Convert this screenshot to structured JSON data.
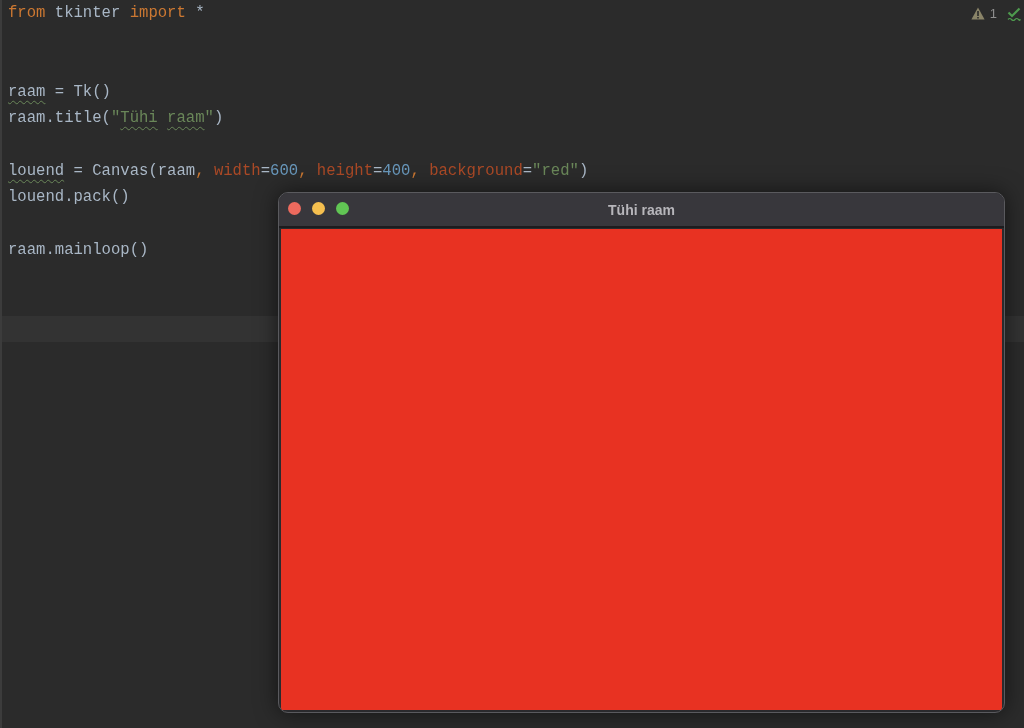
{
  "editor": {
    "inspections": {
      "warning_count": "1"
    },
    "lines": [
      {
        "kind": "code",
        "tokens": [
          {
            "text": "from",
            "kind": "keyword",
            "typo": false
          },
          {
            "text": " tkinter ",
            "kind": "plain",
            "typo": false
          },
          {
            "text": "import",
            "kind": "keyword",
            "typo": false
          },
          {
            "text": " *",
            "kind": "plain",
            "typo": false
          }
        ]
      },
      {
        "kind": "blank"
      },
      {
        "kind": "blank"
      },
      {
        "kind": "code",
        "tokens": [
          {
            "text": "raam",
            "kind": "plain",
            "typo": true
          },
          {
            "text": " = Tk()",
            "kind": "plain",
            "typo": false
          }
        ]
      },
      {
        "kind": "code",
        "tokens": [
          {
            "text": "raam.title(",
            "kind": "plain",
            "typo": false
          },
          {
            "text": "\"",
            "kind": "string",
            "typo": false
          },
          {
            "text": "Tühi",
            "kind": "string",
            "typo": true
          },
          {
            "text": " raam",
            "kind": "string",
            "typo": true
          },
          {
            "text": "\"",
            "kind": "string",
            "typo": false
          },
          {
            "text": ")",
            "kind": "plain",
            "typo": false
          }
        ]
      },
      {
        "kind": "blank"
      },
      {
        "kind": "code",
        "tokens": [
          {
            "text": "louend",
            "kind": "plain",
            "typo": true
          },
          {
            "text": " = Canvas(raam",
            "kind": "plain",
            "typo": false
          },
          {
            "text": ", ",
            "kind": "comma",
            "typo": false
          },
          {
            "text": "width",
            "kind": "param",
            "typo": false
          },
          {
            "text": "=",
            "kind": "plain",
            "typo": false
          },
          {
            "text": "600",
            "kind": "number",
            "typo": false
          },
          {
            "text": ", ",
            "kind": "comma",
            "typo": false
          },
          {
            "text": "height",
            "kind": "param",
            "typo": false
          },
          {
            "text": "=",
            "kind": "plain",
            "typo": false
          },
          {
            "text": "400",
            "kind": "number",
            "typo": false
          },
          {
            "text": ", ",
            "kind": "comma",
            "typo": false
          },
          {
            "text": "background",
            "kind": "param",
            "typo": false
          },
          {
            "text": "=",
            "kind": "plain",
            "typo": false
          },
          {
            "text": "\"red\"",
            "kind": "string",
            "typo": false
          },
          {
            "text": ")",
            "kind": "plain",
            "typo": false
          }
        ]
      },
      {
        "kind": "code",
        "tokens": [
          {
            "text": "louend.pack()",
            "kind": "plain",
            "typo": false
          }
        ]
      },
      {
        "kind": "blank"
      },
      {
        "kind": "code",
        "tokens": [
          {
            "text": "raam.mainloop()",
            "kind": "plain",
            "typo": false
          }
        ]
      },
      {
        "kind": "blank"
      },
      {
        "kind": "blank"
      },
      {
        "kind": "caret_line"
      }
    ]
  },
  "tk_window": {
    "title": "Tühi raam"
  }
}
